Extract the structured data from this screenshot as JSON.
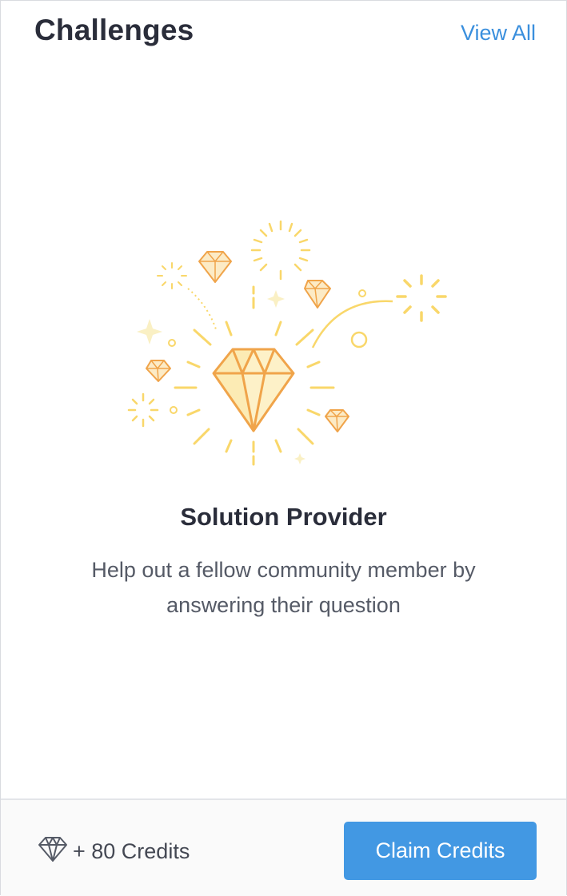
{
  "header": {
    "title": "Challenges",
    "view_all_label": "View All"
  },
  "challenge": {
    "title": "Solution Provider",
    "description": "Help out a fellow community member by answering their question",
    "illustration_icon": "diamond-celebration-icon"
  },
  "footer": {
    "credits_icon": "diamond-icon",
    "credits_label": "+ 80 Credits",
    "claim_button_label": "Claim Credits"
  },
  "colors": {
    "accent": "#4298e3",
    "link": "#3a8fdd",
    "diamond_stroke": "#f0a44a",
    "sparkle": "#f9d76a"
  }
}
